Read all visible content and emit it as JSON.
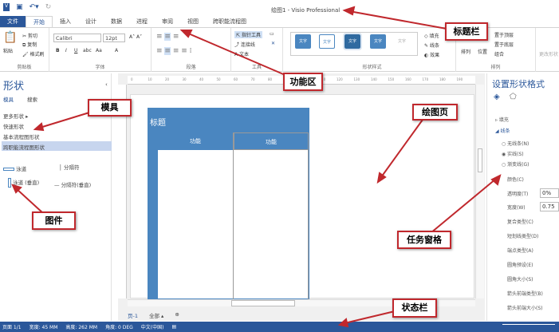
{
  "window": {
    "title": "绘图1 - Visio Professional"
  },
  "tabs": [
    "文件",
    "开始",
    "插入",
    "设计",
    "数据",
    "进程",
    "审阅",
    "视图",
    "跨职能流程图"
  ],
  "ribbon": {
    "clipboard": {
      "label": "剪贴板",
      "paste": "粘贴",
      "cut": "剪切",
      "copy": "复制",
      "format_painter": "格式刷"
    },
    "font": {
      "label": "字体",
      "font_name": "Calibri",
      "font_size": "12pt",
      "bold": "B",
      "italic": "I",
      "underline": "U",
      "strike": "abc",
      "case": "Aa",
      "color": "A"
    },
    "paragraph": {
      "label": "段落"
    },
    "tools": {
      "label": "工具",
      "pointer": "指针工具",
      "connector": "连接线",
      "text": "文本"
    },
    "shape_styles": {
      "label": "形状样式",
      "style_text": "文字",
      "fill": "填充",
      "line": "线条",
      "effects": "效果"
    },
    "arrange": {
      "label": "排列",
      "arrange": "排列",
      "position": "位置",
      "bring_front": "置于顶层",
      "send_back": "置于底层",
      "group": "组合"
    },
    "edit": {
      "change_shape": "更改形状"
    }
  },
  "shapes_panel": {
    "title": "形状",
    "tabs": [
      "模具",
      "搜索"
    ],
    "more": "更多形状",
    "items": [
      "快速形状",
      "基本流程图形状",
      "跨职能流程图形状"
    ],
    "masters": [
      "泳道",
      "分隔符",
      "泳道 (垂直)",
      "分隔符(垂直)"
    ]
  },
  "ruler": [
    "0",
    "10",
    "20",
    "30",
    "40",
    "50",
    "60",
    "70",
    "80",
    "90",
    "100",
    "110",
    "120",
    "130",
    "140",
    "150",
    "160",
    "170",
    "180",
    "190"
  ],
  "diagram": {
    "title": "标题",
    "lanes": [
      "功能",
      "功能"
    ]
  },
  "page_tabs": {
    "page": "页-1",
    "all": "全部"
  },
  "format_pane": {
    "title": "设置形状格式",
    "fill": "填充",
    "line": "线条",
    "options": [
      "无线条(N)",
      "实线(S)",
      "渐变线(G)"
    ],
    "props": [
      "颜色(C)",
      "透明度(T)",
      "宽度(W)",
      "复合类型(C)",
      "短划线类型(D)",
      "端点类型(A)",
      "圆角预设(E)",
      "圆角大小(S)",
      "箭头前端类型(B)",
      "箭头前端大小(S)"
    ],
    "transparency": "0%",
    "width": "0.75"
  },
  "status": {
    "page": "页面 1/1",
    "width": "宽度: 45 MM",
    "height": "高度: 262 MM",
    "angle": "角度: 0 DEG",
    "lang": "中文(中国)"
  },
  "annotations": {
    "titlebar": "标题栏",
    "ribbon": "功能区",
    "stencil": "模具",
    "master": "图件",
    "drawing_page": "绘图页",
    "task_pane": "任务窗格",
    "statusbar": "状态栏"
  },
  "colors": {
    "accent": "#2b579a",
    "lane": "#4a86c0",
    "annotation": "#c0282d"
  }
}
